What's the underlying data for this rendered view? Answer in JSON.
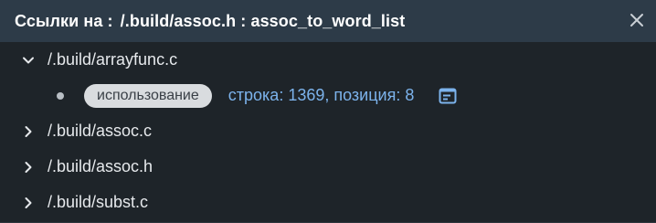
{
  "header": {
    "prefix": "Ссылки на :",
    "target": "/.build/assoc.h : assoc_to_word_list",
    "close_icon": "close-icon"
  },
  "files": [
    {
      "label": "/.build/arrayfunc.c",
      "expanded": true,
      "references": [
        {
          "kind": "использование",
          "location": "строка: 1369, позиция: 8",
          "icon": "go-to-source-icon"
        }
      ]
    },
    {
      "label": "/.build/assoc.c",
      "expanded": false
    },
    {
      "label": "/.build/assoc.h",
      "expanded": false
    },
    {
      "label": "/.build/subst.c",
      "expanded": false
    }
  ],
  "colors": {
    "header_bg": "#2d3b48",
    "panel_bg": "#1e2429",
    "link": "#7cb3ec",
    "badge_bg": "#d9dcdf"
  }
}
